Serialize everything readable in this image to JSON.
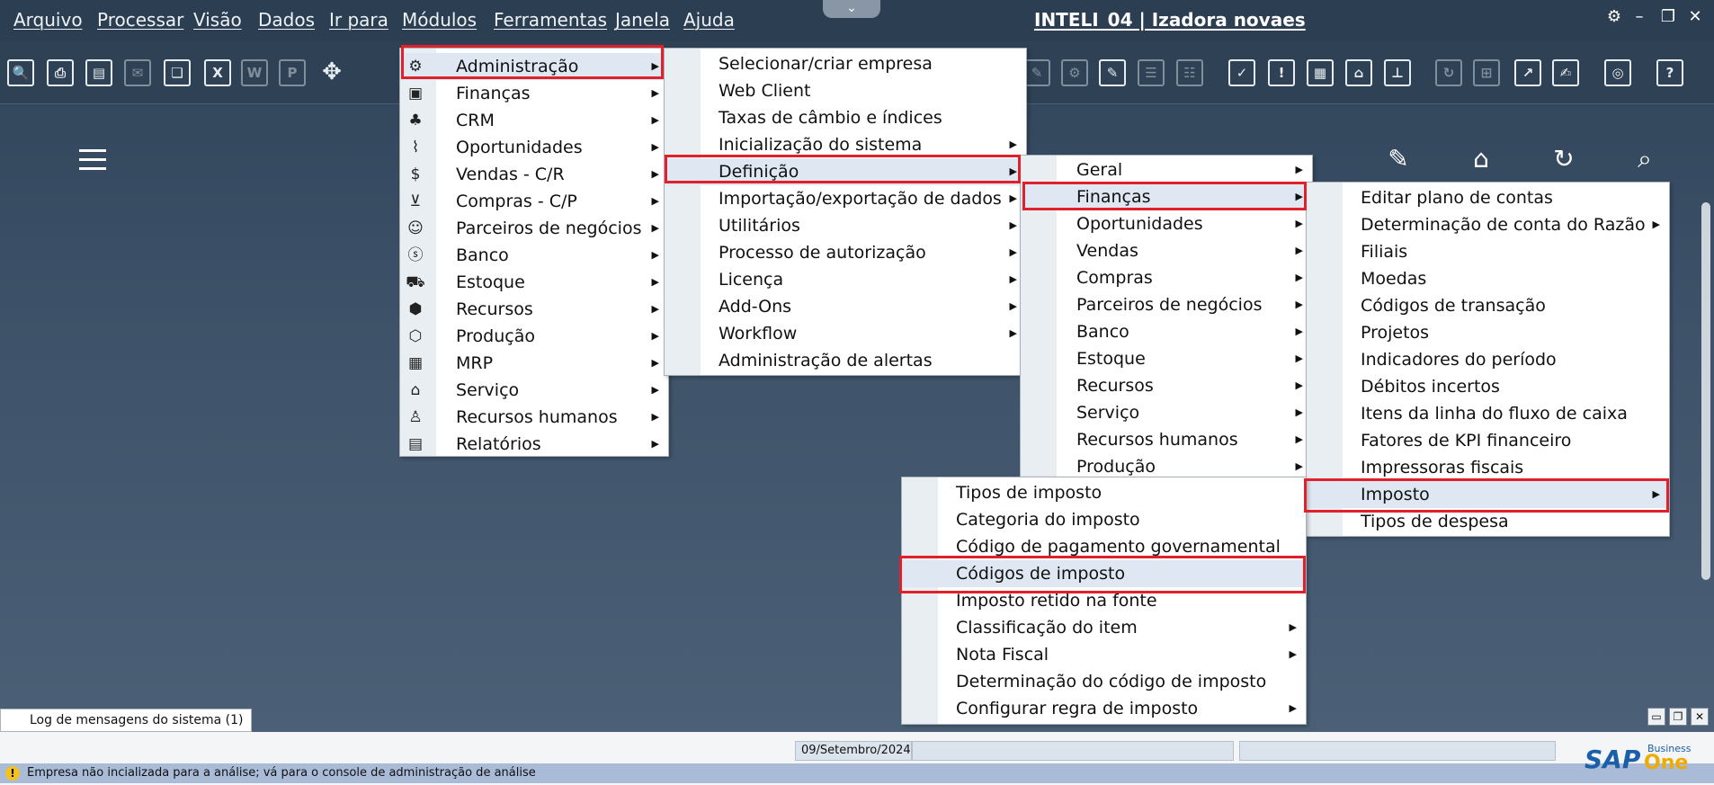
{
  "menubar": {
    "items": [
      "Arquivo",
      "Processar",
      "Visão",
      "Dados",
      "Ir para",
      "Módulos",
      "Ferramentas",
      "Janela",
      "Ajuda"
    ],
    "title": "INTELI_04 | Izadora novaes"
  },
  "menu_modulos": [
    {
      "label": "Administração",
      "icon": "gear-icon"
    },
    {
      "label": "Finanças",
      "icon": "finance-icon"
    },
    {
      "label": "CRM",
      "icon": "crm-icon"
    },
    {
      "label": "Oportunidades",
      "icon": "chart-icon"
    },
    {
      "label": "Vendas - C/R",
      "icon": "dollar-icon"
    },
    {
      "label": "Compras - C/P",
      "icon": "cart-icon"
    },
    {
      "label": "Parceiros de negócios",
      "icon": "partners-icon"
    },
    {
      "label": "Banco",
      "icon": "moneybag-icon"
    },
    {
      "label": "Estoque",
      "icon": "truck-icon"
    },
    {
      "label": "Recursos",
      "icon": "hexagon-icon"
    },
    {
      "label": "Produção",
      "icon": "box-icon"
    },
    {
      "label": "MRP",
      "icon": "calendar-icon"
    },
    {
      "label": "Serviço",
      "icon": "bank-icon"
    },
    {
      "label": "Recursos humanos",
      "icon": "person-icon"
    },
    {
      "label": "Relatórios",
      "icon": "report-icon"
    }
  ],
  "menu_administracao": [
    {
      "label": "Selecionar/criar empresa",
      "sub": false
    },
    {
      "label": "Web Client",
      "sub": false
    },
    {
      "label": "Taxas de câmbio e índices",
      "sub": false
    },
    {
      "label": "Inicialização do sistema",
      "sub": true
    },
    {
      "label": "Definição",
      "sub": true
    },
    {
      "label": "Importação/exportação de dados",
      "sub": true
    },
    {
      "label": "Utilitários",
      "sub": true
    },
    {
      "label": "Processo de autorização",
      "sub": true
    },
    {
      "label": "Licença",
      "sub": true
    },
    {
      "label": "Add-Ons",
      "sub": true
    },
    {
      "label": "Workflow",
      "sub": true
    },
    {
      "label": "Administração de alertas",
      "sub": false
    }
  ],
  "menu_definicao": [
    "Geral",
    "Finanças",
    "Oportunidades",
    "Vendas",
    "Compras",
    "Parceiros de negócios",
    "Banco",
    "Estoque",
    "Recursos",
    "Serviço",
    "Recursos humanos",
    "Produção"
  ],
  "menu_financas": [
    {
      "label": "Editar plano de contas",
      "sub": false
    },
    {
      "label": "Determinação de conta do Razão",
      "sub": true
    },
    {
      "label": "Filiais",
      "sub": false
    },
    {
      "label": "Moedas",
      "sub": false
    },
    {
      "label": "Códigos de transação",
      "sub": false
    },
    {
      "label": "Projetos",
      "sub": false
    },
    {
      "label": "Indicadores do período",
      "sub": false
    },
    {
      "label": "Débitos incertos",
      "sub": false
    },
    {
      "label": "Itens da linha do fluxo de caixa",
      "sub": false
    },
    {
      "label": "Fatores de KPI financeiro",
      "sub": false
    },
    {
      "label": "Impressoras fiscais",
      "sub": false
    },
    {
      "label": "Imposto",
      "sub": true
    },
    {
      "label": "Tipos de despesa",
      "sub": false
    }
  ],
  "menu_imposto": [
    {
      "label": "Tipos de imposto",
      "sub": false
    },
    {
      "label": "Categoria do imposto",
      "sub": false
    },
    {
      "label": "Código de pagamento governamental",
      "sub": false
    },
    {
      "label": "Códigos de imposto",
      "sub": false
    },
    {
      "label": "Imposto retido na fonte",
      "sub": false
    },
    {
      "label": "Classificação do item",
      "sub": true
    },
    {
      "label": "Nota Fiscal",
      "sub": true
    },
    {
      "label": "Determinação do código de imposto",
      "sub": false
    },
    {
      "label": "Configurar regra de imposto",
      "sub": true
    }
  ],
  "bottom": {
    "log_tab": "Log de mensagens do sistema (1)",
    "date": "09/Setembro/2024",
    "message": "Empresa não incializada para a análise; vá para o console de administração de análise",
    "logo_main": "SAP",
    "logo_sub": "Business",
    "logo_one": "One"
  },
  "colors": {
    "highlight_box": "#e0202a",
    "background": "#3d5168"
  }
}
